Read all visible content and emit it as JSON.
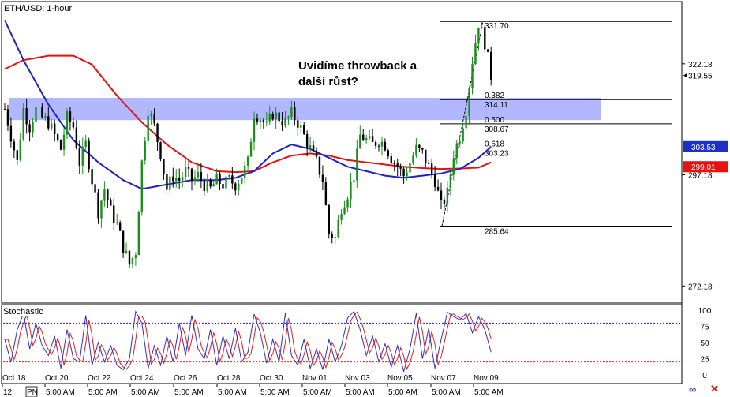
{
  "chart_data": {
    "type": "candlestick",
    "title": "ETH/USD: 1-hour",
    "annotation": "Uvidíme throwback a\ndalší růst?",
    "colors": {
      "bull": "#1a8f1a",
      "bear": "#000000",
      "ma_fast": "#2020c8",
      "ma_slow": "#e81010",
      "zone": "#a9b0ff",
      "badge_blue": "#1c2fc8",
      "badge_red": "#e81010",
      "stoch_k": "#3030c0",
      "stoch_d": "#e02020",
      "level_upper": "#2020c8",
      "level_lower": "#e02020"
    },
    "y_axis": {
      "range": [
        268.5,
        336.0
      ],
      "tick_labels": [
        "322.18",
        "297.18",
        "272.18"
      ],
      "current_price": "319.55",
      "badges": [
        {
          "label": "303.53",
          "value": 303.53,
          "color": "blue"
        },
        {
          "label": "299.01",
          "value": 299.01,
          "color": "red"
        }
      ]
    },
    "x_axis": {
      "ticks": [
        {
          "date": "Oct 18",
          "time": "12:"
        },
        {
          "date": "Oct 20",
          "time": "5:00 AM"
        },
        {
          "date": "Oct 22",
          "time": "5:00 AM"
        },
        {
          "date": "Oct 24",
          "time": "5:00 AM"
        },
        {
          "date": "Oct 26",
          "time": "5:00 AM"
        },
        {
          "date": "Oct 28",
          "time": "5:00 AM"
        },
        {
          "date": "Oct 30",
          "time": "5:00 AM"
        },
        {
          "date": "Nov 01",
          "time": "5:00 AM"
        },
        {
          "date": "Nov 03",
          "time": "5:00 AM"
        },
        {
          "date": "Nov 05",
          "time": "5:00 AM"
        },
        {
          "date": "Nov 07",
          "time": "5:00 AM"
        },
        {
          "date": "Nov 09",
          "time": "5:00 AM"
        }
      ],
      "left_fragment": "PN"
    },
    "fibonacci": {
      "high": 331.7,
      "low": 285.64,
      "levels": [
        {
          "ratio": "0.382",
          "price": "314.11",
          "value": 314.11
        },
        {
          "ratio": "0.500",
          "price": "308.67",
          "value": 308.67
        },
        {
          "ratio": "0.618",
          "price": "303.23",
          "value": 303.23
        }
      ],
      "high_label": "331.70",
      "low_label": "285.64"
    },
    "resistance_zone": {
      "from": 309.5,
      "to": 314.5
    },
    "stochastic": {
      "title": "Stochastic",
      "tick_labels": [
        "100",
        "75",
        "50",
        "25",
        "0"
      ],
      "levels": [
        80,
        20
      ]
    },
    "price_path": [
      [
        0,
        312
      ],
      [
        2,
        306
      ],
      [
        4,
        300
      ],
      [
        6,
        312
      ],
      [
        8,
        308
      ],
      [
        10,
        312
      ],
      [
        12,
        310
      ],
      [
        14,
        309
      ],
      [
        16,
        306
      ],
      [
        18,
        303
      ],
      [
        20,
        310
      ],
      [
        22,
        308
      ],
      [
        24,
        300
      ],
      [
        26,
        304
      ],
      [
        28,
        296
      ],
      [
        30,
        289
      ],
      [
        32,
        294
      ],
      [
        34,
        289
      ],
      [
        36,
        286
      ],
      [
        38,
        281
      ],
      [
        40,
        277
      ],
      [
        42,
        280
      ],
      [
        44,
        300
      ],
      [
        46,
        312
      ],
      [
        48,
        308
      ],
      [
        50,
        302
      ],
      [
        52,
        294
      ],
      [
        54,
        297
      ],
      [
        56,
        296
      ],
      [
        58,
        298
      ],
      [
        60,
        296
      ],
      [
        62,
        297
      ],
      [
        64,
        295
      ],
      [
        66,
        294
      ],
      [
        68,
        296
      ],
      [
        70,
        295
      ],
      [
        72,
        296
      ],
      [
        74,
        295
      ],
      [
        76,
        297
      ],
      [
        78,
        300
      ],
      [
        80,
        311
      ],
      [
        82,
        310
      ],
      [
        84,
        308
      ],
      [
        86,
        311
      ],
      [
        88,
        310
      ],
      [
        90,
        309
      ],
      [
        92,
        311
      ],
      [
        94,
        309
      ],
      [
        96,
        306
      ],
      [
        98,
        303
      ],
      [
        100,
        300
      ],
      [
        102,
        296
      ],
      [
        104,
        284
      ],
      [
        106,
        283
      ],
      [
        108,
        290
      ],
      [
        110,
        293
      ],
      [
        112,
        297
      ],
      [
        114,
        306
      ],
      [
        116,
        305
      ],
      [
        118,
        304
      ],
      [
        120,
        305
      ],
      [
        122,
        304
      ],
      [
        124,
        301
      ],
      [
        126,
        299
      ],
      [
        128,
        297
      ],
      [
        130,
        300
      ],
      [
        132,
        303
      ],
      [
        134,
        302
      ],
      [
        136,
        299
      ],
      [
        138,
        296
      ],
      [
        140,
        290
      ],
      [
        142,
        293
      ],
      [
        144,
        302
      ],
      [
        146,
        306
      ],
      [
        148,
        312
      ],
      [
        150,
        323
      ],
      [
        152,
        331.5
      ],
      [
        154,
        327
      ],
      [
        156,
        319.5
      ]
    ],
    "ma_fast_path": [
      [
        0,
        332
      ],
      [
        6,
        323
      ],
      [
        14,
        313
      ],
      [
        22,
        305
      ],
      [
        30,
        300
      ],
      [
        38,
        296
      ],
      [
        44,
        294
      ],
      [
        52,
        295
      ],
      [
        60,
        296
      ],
      [
        68,
        296
      ],
      [
        74,
        296.5
      ],
      [
        80,
        298
      ],
      [
        86,
        302
      ],
      [
        92,
        304
      ],
      [
        98,
        303
      ],
      [
        104,
        301
      ],
      [
        110,
        299
      ],
      [
        116,
        298
      ],
      [
        122,
        297
      ],
      [
        128,
        296.5
      ],
      [
        134,
        297
      ],
      [
        140,
        297.5
      ],
      [
        146,
        298.5
      ],
      [
        152,
        301
      ],
      [
        156,
        303.5
      ]
    ],
    "ma_slow_path": [
      [
        0,
        321
      ],
      [
        6,
        323
      ],
      [
        14,
        324
      ],
      [
        22,
        324
      ],
      [
        28,
        322
      ],
      [
        36,
        315
      ],
      [
        44,
        309
      ],
      [
        52,
        304
      ],
      [
        60,
        300
      ],
      [
        68,
        298
      ],
      [
        74,
        297.8
      ],
      [
        80,
        298
      ],
      [
        86,
        300
      ],
      [
        92,
        301.5
      ],
      [
        98,
        302
      ],
      [
        104,
        301.5
      ],
      [
        110,
        300.5
      ],
      [
        116,
        300
      ],
      [
        122,
        299.5
      ],
      [
        128,
        299
      ],
      [
        134,
        298.7
      ],
      [
        140,
        298.5
      ],
      [
        146,
        298.6
      ],
      [
        152,
        298.8
      ],
      [
        156,
        300
      ]
    ],
    "stoch_path": [
      [
        0,
        55
      ],
      [
        2,
        20
      ],
      [
        4,
        70
      ],
      [
        6,
        95
      ],
      [
        8,
        40
      ],
      [
        10,
        80
      ],
      [
        12,
        45
      ],
      [
        14,
        30
      ],
      [
        16,
        60
      ],
      [
        18,
        10
      ],
      [
        20,
        70
      ],
      [
        22,
        25
      ],
      [
        24,
        20
      ],
      [
        26,
        92
      ],
      [
        28,
        15
      ],
      [
        30,
        50
      ],
      [
        32,
        20
      ],
      [
        34,
        45
      ],
      [
        36,
        15
      ],
      [
        38,
        8
      ],
      [
        40,
        25
      ],
      [
        42,
        98
      ],
      [
        44,
        80
      ],
      [
        46,
        10
      ],
      [
        48,
        45
      ],
      [
        50,
        15
      ],
      [
        52,
        60
      ],
      [
        54,
        20
      ],
      [
        56,
        80
      ],
      [
        58,
        30
      ],
      [
        60,
        92
      ],
      [
        62,
        40
      ],
      [
        64,
        25
      ],
      [
        66,
        70
      ],
      [
        68,
        15
      ],
      [
        70,
        60
      ],
      [
        72,
        25
      ],
      [
        74,
        72
      ],
      [
        76,
        20
      ],
      [
        78,
        35
      ],
      [
        80,
        94
      ],
      [
        82,
        65
      ],
      [
        84,
        18
      ],
      [
        86,
        55
      ],
      [
        88,
        20
      ],
      [
        90,
        95
      ],
      [
        92,
        30
      ],
      [
        94,
        15
      ],
      [
        96,
        55
      ],
      [
        98,
        10
      ],
      [
        100,
        40
      ],
      [
        102,
        8
      ],
      [
        104,
        55
      ],
      [
        106,
        20
      ],
      [
        108,
        45
      ],
      [
        110,
        88
      ],
      [
        112,
        98
      ],
      [
        114,
        70
      ],
      [
        116,
        30
      ],
      [
        118,
        60
      ],
      [
        120,
        20
      ],
      [
        122,
        48
      ],
      [
        124,
        12
      ],
      [
        126,
        45
      ],
      [
        128,
        5
      ],
      [
        130,
        40
      ],
      [
        132,
        95
      ],
      [
        134,
        25
      ],
      [
        136,
        72
      ],
      [
        138,
        10
      ],
      [
        140,
        55
      ],
      [
        142,
        97
      ],
      [
        144,
        90
      ],
      [
        146,
        85
      ],
      [
        148,
        95
      ],
      [
        150,
        65
      ],
      [
        152,
        90
      ],
      [
        154,
        70
      ],
      [
        156,
        35
      ]
    ]
  },
  "toolbar": {
    "left_fragment": "12",
    "icons": [
      "link-icon",
      "close-icon"
    ]
  }
}
